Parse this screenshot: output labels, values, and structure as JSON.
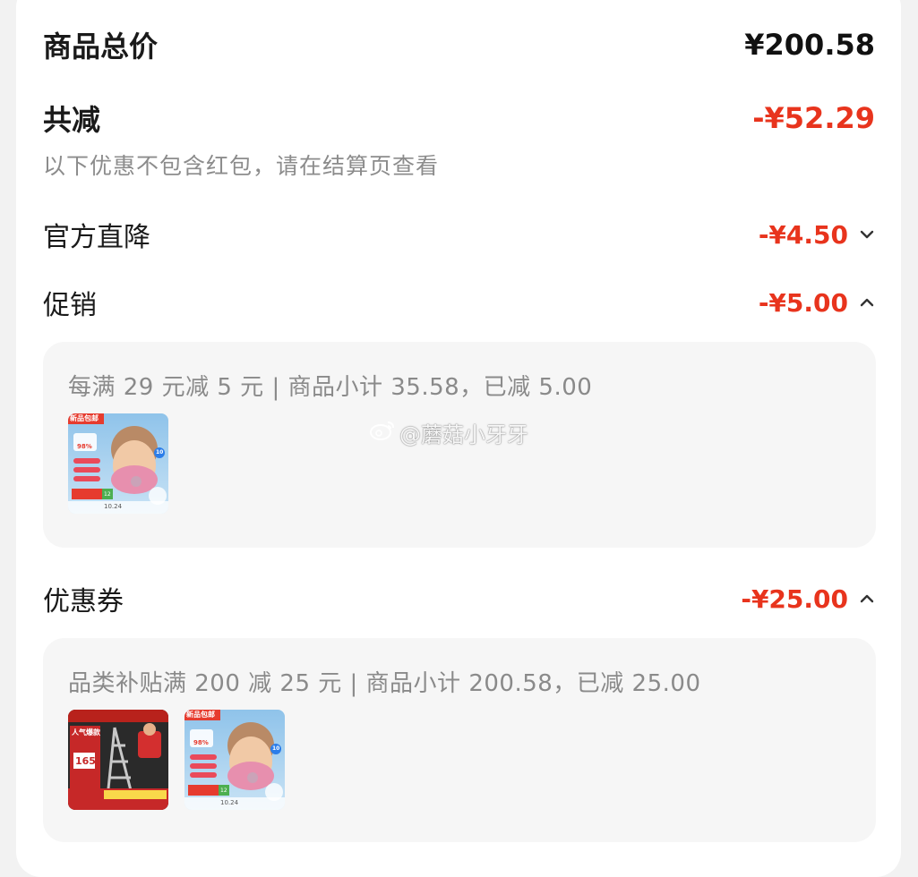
{
  "summary": {
    "total_label": "商品总价",
    "total_amount": "¥200.58",
    "reduce_label": "共减",
    "reduce_amount": "-¥52.29",
    "note": "以下优惠不包含红包，请在结算页查看"
  },
  "sections": {
    "official": {
      "label": "官方直降",
      "amount": "-¥4.50",
      "expanded": false
    },
    "promo": {
      "label": "促销",
      "amount": "-¥5.00",
      "expanded": true,
      "detail": "每满 29 元减 5 元 | 商品小计 35.58，已减 5.00",
      "products": [
        "child-mask-product"
      ]
    },
    "coupon": {
      "label": "优惠券",
      "amount": "-¥25.00",
      "expanded": true,
      "detail": "品类补贴满 200 减 25 元 | 商品小计 200.58，已减 25.00",
      "products": [
        "ladder-product",
        "child-mask-product"
      ]
    }
  },
  "thumbs": {
    "mask_banner": "新品包邮",
    "mask_percent": "98%",
    "mask_tag": "10",
    "mask_price": "10.24",
    "mask_count": "12",
    "ladder_banner": "人气爆款",
    "ladder_price": "165"
  },
  "watermark": {
    "text": "@蘑菇小牙牙",
    "icon": "weibo-icon"
  },
  "colors": {
    "accent": "#e8341d",
    "text": "#1a1a1a",
    "muted": "#8c8c8c",
    "panel": "#f6f6f6"
  }
}
